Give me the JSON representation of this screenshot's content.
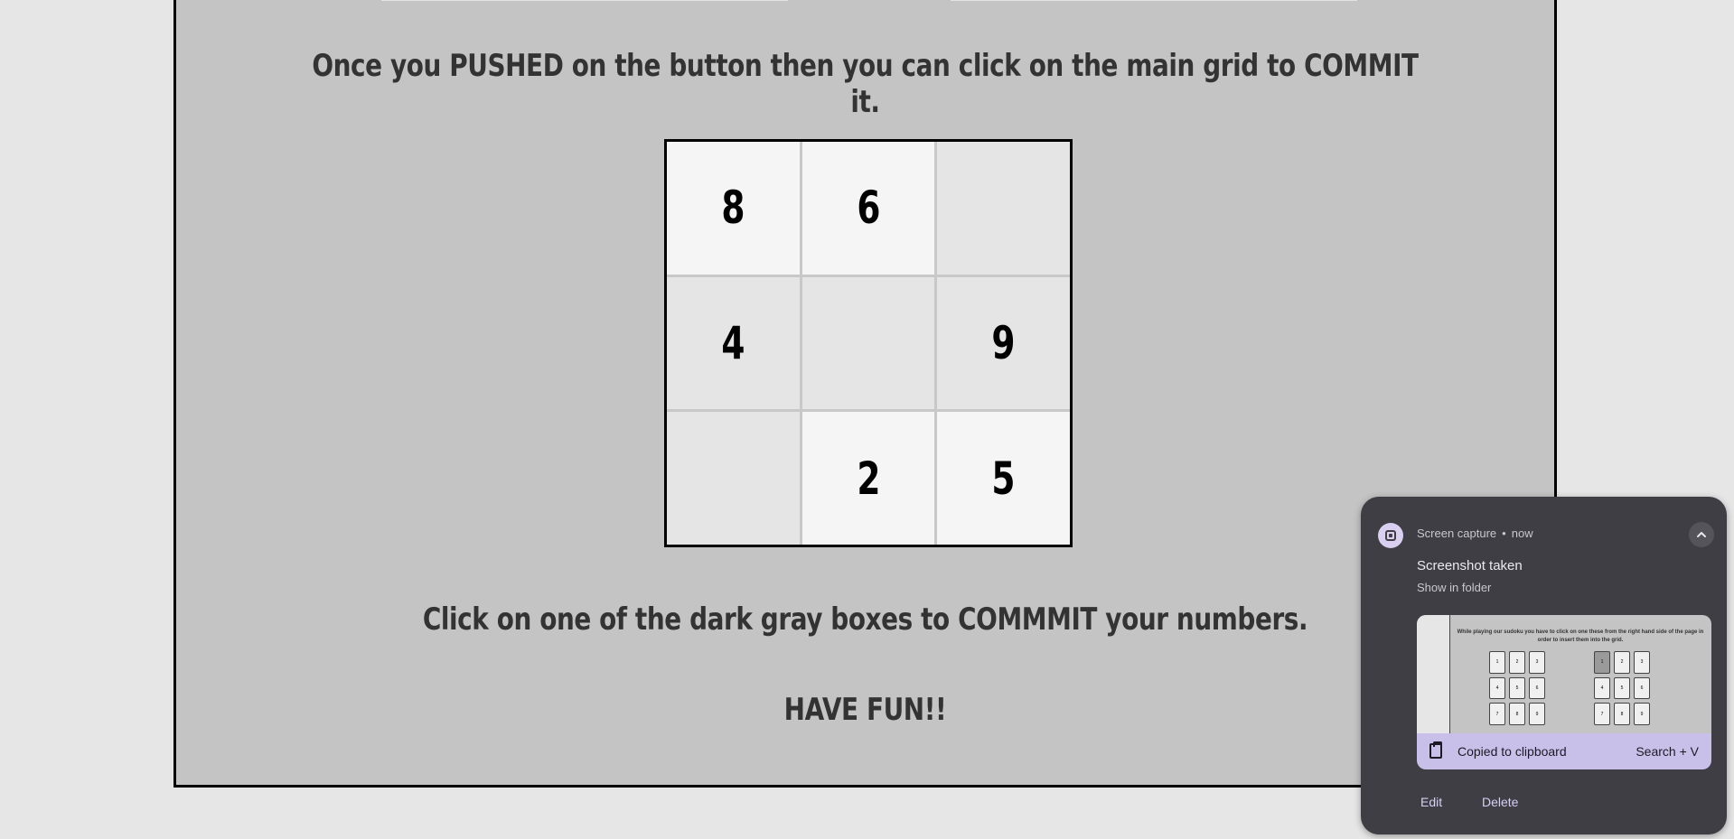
{
  "page": {
    "instruction_commit": "Once you PUSHED on the button then you can click on the main grid to COMMIT it.",
    "instruction_click": "Click on one of the dark gray boxes to COMMMIT your numbers.",
    "closing": "HAVE FUN!!"
  },
  "grid": {
    "cells": [
      {
        "value": "8",
        "state": "given"
      },
      {
        "value": "6",
        "state": "given"
      },
      {
        "value": "",
        "state": "empty"
      },
      {
        "value": "4",
        "state": "empty"
      },
      {
        "value": "",
        "state": "empty"
      },
      {
        "value": "9",
        "state": "empty"
      },
      {
        "value": "",
        "state": "empty"
      },
      {
        "value": "2",
        "state": "given"
      },
      {
        "value": "5",
        "state": "given"
      }
    ]
  },
  "notification": {
    "app_name": "Screen capture",
    "separator": "•",
    "time": "now",
    "title": "Screenshot taken",
    "subtitle": "Show in folder",
    "preview": {
      "line1": "While playing our sudoku you have to click on one these from the right hand side of the page in",
      "line2": "order to insert them into the grid.",
      "grid_left": [
        "1",
        "2",
        "3",
        "4",
        "5",
        "6",
        "7",
        "8",
        "9"
      ],
      "grid_right": [
        "1",
        "2",
        "3",
        "4",
        "5",
        "6",
        "7",
        "8",
        "9"
      ]
    },
    "clipboard_label": "Copied to clipboard",
    "clipboard_shortcut": "Search + V",
    "edit_label": "Edit",
    "delete_label": "Delete",
    "icons": {
      "app": "screen-capture-icon",
      "collapse": "chevron-up-icon",
      "clipboard": "clipboard-check-icon"
    }
  }
}
